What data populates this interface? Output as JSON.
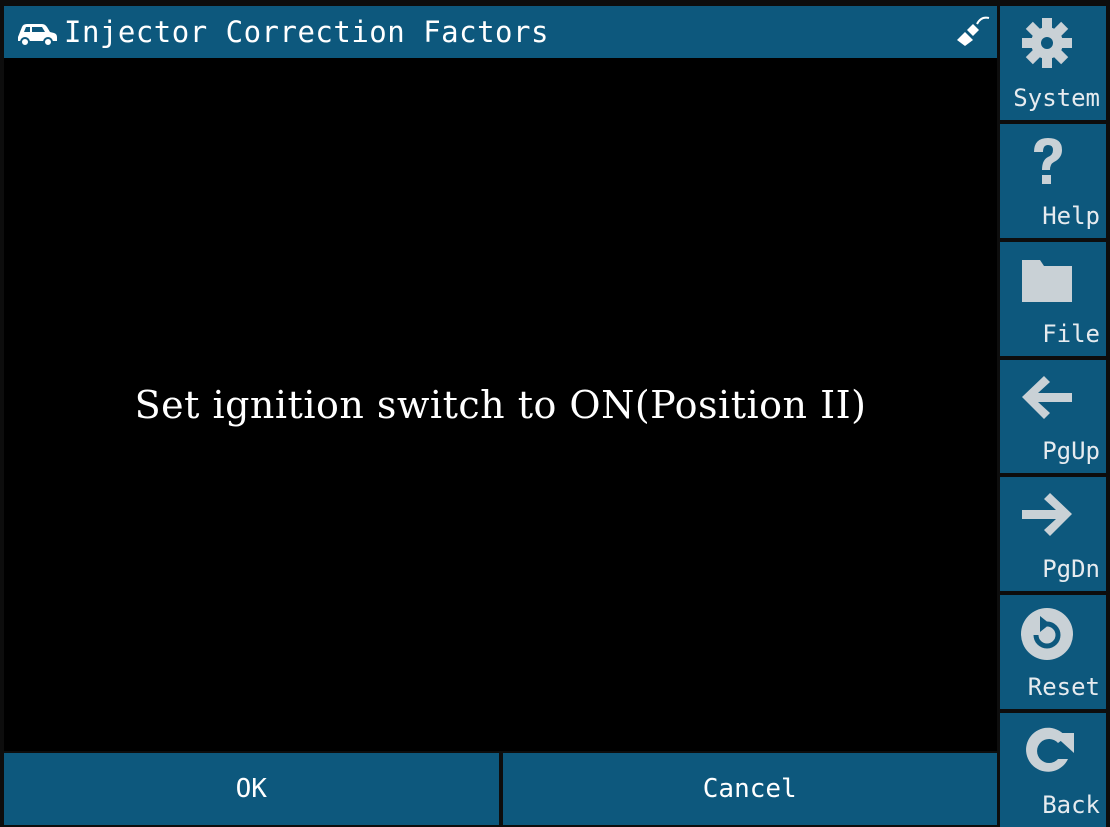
{
  "header": {
    "title": "Injector Correction Factors",
    "vehicle_icon": "car-icon",
    "connection_icon": "plug-icon"
  },
  "main": {
    "message": "Set ignition switch to ON(Position II)"
  },
  "buttons": {
    "ok_label": "OK",
    "cancel_label": "Cancel"
  },
  "sidebar": {
    "items": [
      {
        "label": "System",
        "icon": "gear-icon"
      },
      {
        "label": "Help",
        "icon": "question-icon"
      },
      {
        "label": "File",
        "icon": "folder-icon"
      },
      {
        "label": "PgUp",
        "icon": "arrow-left-icon"
      },
      {
        "label": "PgDn",
        "icon": "arrow-right-icon"
      },
      {
        "label": "Reset",
        "icon": "reset-icon"
      },
      {
        "label": "Back",
        "icon": "back-icon"
      }
    ]
  },
  "colors": {
    "bar": "#0d587d",
    "background": "#000000",
    "icon": "#c9d1d6",
    "text": "#ffffff"
  }
}
